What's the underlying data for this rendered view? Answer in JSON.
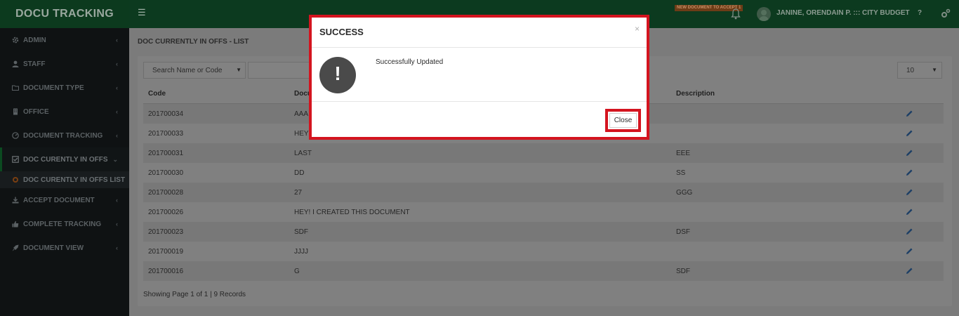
{
  "app": {
    "title": "DOCU TRACKING",
    "notice_badge": "NEW DOCUMENT TO ACCEPT 1",
    "user_label": "JANINE, ORENDAIN P. ::: CITY BUDGET",
    "help_label": "?"
  },
  "sidebar": {
    "items": [
      {
        "label": "ADMIN",
        "icon": "gear-icon"
      },
      {
        "label": "STAFF",
        "icon": "user-icon"
      },
      {
        "label": "DOCUMENT TYPE",
        "icon": "folder-icon"
      },
      {
        "label": "OFFICE",
        "icon": "building-icon"
      },
      {
        "label": "DOCUMENT TRACKING",
        "icon": "dashboard-icon"
      },
      {
        "label": "DOC CURENTLY IN OFFS",
        "icon": "checkbox-icon"
      },
      {
        "label": "ACCEPT DOCUMENT",
        "icon": "download-icon"
      },
      {
        "label": "COMPLETE TRACKING",
        "icon": "thumbs-up-icon"
      },
      {
        "label": "DOCUMENT VIEW",
        "icon": "rocket-icon"
      }
    ],
    "sub_item": {
      "label": "DOC CURENTLY IN OFFS LIST"
    }
  },
  "main": {
    "page_title": "DOC CURRENTLY IN OFFS - LIST",
    "search_select": {
      "value": "Search Name or Code"
    },
    "page_size": {
      "value": "10"
    },
    "table": {
      "headers": {
        "code": "Code",
        "document": "Docu",
        "description": "Description"
      },
      "rows": [
        {
          "code": "201700034",
          "document": "AAA",
          "description": ""
        },
        {
          "code": "201700033",
          "document": "HEY",
          "description": ""
        },
        {
          "code": "201700031",
          "document": "LAST",
          "description": "EEE"
        },
        {
          "code": "201700030",
          "document": "DD",
          "description": "SS"
        },
        {
          "code": "201700028",
          "document": "27",
          "description": "GGG"
        },
        {
          "code": "201700026",
          "document": "HEY! I CREATED THIS DOCUMENT",
          "description": ""
        },
        {
          "code": "201700023",
          "document": "SDF",
          "description": "DSF"
        },
        {
          "code": "201700019",
          "document": "JJJJ",
          "description": ""
        },
        {
          "code": "201700016",
          "document": "G",
          "description": "SDF"
        }
      ]
    },
    "footer_info": "Showing Page 1 of 1 | 9 Records"
  },
  "modal": {
    "title": "SUCCESS",
    "close_x": "×",
    "message": "Successfully Updated",
    "close_label": "Close"
  },
  "colors": {
    "header_green": "#0c3a1f",
    "sidebar_bg": "#0f1213",
    "highlight_red": "#d4141f",
    "badge_orange": "#6d3c17"
  }
}
